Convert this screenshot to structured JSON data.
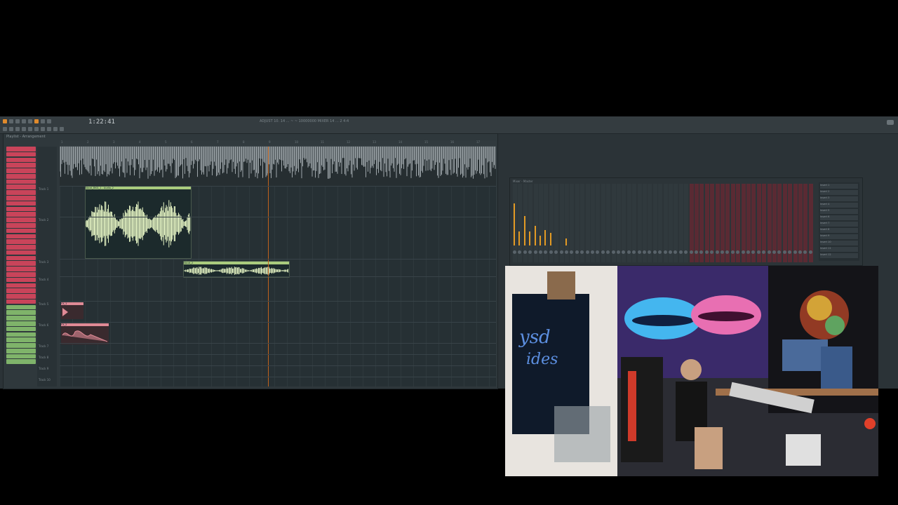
{
  "toolbar": {
    "time": "1:22:41",
    "hint": "ADJUST 10. 14 ... ~ ~ 10000000 MIXER 14 ... 2 4:4",
    "title_row": "Playlist - Arrangement"
  },
  "playlist": {
    "title": "Playlist - Arrangement",
    "ruler": [
      "1",
      "2",
      "3",
      "4",
      "5",
      "6",
      "7",
      "8",
      "9",
      "10",
      "11",
      "12",
      "13",
      "14",
      "15",
      "16",
      "17"
    ],
    "tracks": [
      "Track 1",
      "Track 2",
      "Track 3",
      "Track 4",
      "Track 5",
      "Track 6",
      "Track 7",
      "Track 8",
      "Track 9",
      "Track 10"
    ],
    "clips": [
      {
        "label": "Vocal_BKG_1 - Audio_2",
        "color": "#aacc7e"
      },
      {
        "label": "Vocal_2",
        "color": "#aacc7e"
      },
      {
        "label": "FX_1",
        "color": "#e08a96"
      },
      {
        "label": "FX_2",
        "color": "#e08a96"
      }
    ],
    "pattern_count": 40,
    "green_from": 29
  },
  "mixer": {
    "title": "Mixer - Master",
    "inserts": [
      "Insert 1",
      "Insert 2",
      "Insert 3",
      "Insert 4",
      "Insert 5",
      "Insert 6",
      "Insert 7",
      "Insert 8",
      "Insert 9",
      "Insert 10",
      "Insert 11",
      "Insert 12"
    ]
  },
  "webcam": {
    "description_colors": {
      "wall": "#2a2a33",
      "tapestry": "#3a6fd0",
      "lips_pink": "#e86fb2",
      "lips_blue": "#44b6ef"
    }
  },
  "colors": {
    "accent": "#e08a2c",
    "pattern_red": "#c9445a",
    "pattern_green": "#7fb36a",
    "clip_green": "#aacc7e",
    "clip_pink": "#e08a96"
  }
}
